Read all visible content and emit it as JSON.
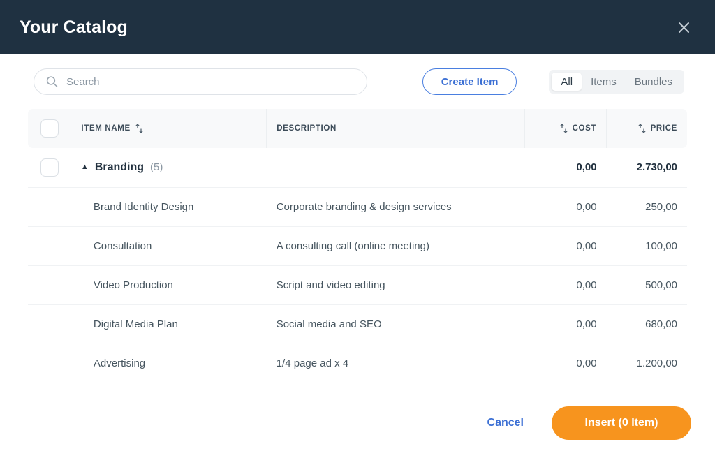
{
  "titlebar": {
    "title": "Your Catalog",
    "close_icon": "close-icon"
  },
  "toolbar": {
    "search": {
      "placeholder": "Search",
      "value": "",
      "icon": "search-icon"
    },
    "create_item_label": "Create Item",
    "filters": [
      {
        "label": "All",
        "active": true
      },
      {
        "label": "Items",
        "active": false
      },
      {
        "label": "Bundles",
        "active": false
      }
    ]
  },
  "table": {
    "columns": [
      {
        "key": "check",
        "label": "",
        "sortable": false
      },
      {
        "key": "name",
        "label": "ITEM NAME",
        "sortable": true
      },
      {
        "key": "description",
        "label": "DESCRIPTION",
        "sortable": false
      },
      {
        "key": "cost",
        "label": "COST",
        "sortable": true
      },
      {
        "key": "price",
        "label": "PRICE",
        "sortable": true
      }
    ],
    "group": {
      "name": "Branding",
      "count": "(5)",
      "expanded": true,
      "caret_icon": "caret-up-icon",
      "cost": "0,00",
      "price": "2.730,00"
    },
    "rows": [
      {
        "name": "Brand Identity Design",
        "description": "Corporate branding & design services",
        "cost": "0,00",
        "price": "250,00"
      },
      {
        "name": "Consultation",
        "description": "A consulting call (online meeting)",
        "cost": "0,00",
        "price": "100,00"
      },
      {
        "name": "Video Production",
        "description": "Script and video editing",
        "cost": "0,00",
        "price": "500,00"
      },
      {
        "name": "Digital Media Plan",
        "description": "Social media and SEO",
        "cost": "0,00",
        "price": "680,00"
      },
      {
        "name": "Advertising",
        "description": "1/4 page ad x 4",
        "cost": "0,00",
        "price": "1.200,00"
      }
    ]
  },
  "footer": {
    "cancel_label": "Cancel",
    "insert_label": "Insert (0 Item)"
  },
  "colors": {
    "titlebar_bg": "#1f3141",
    "accent_blue": "#3b6fd4",
    "accent_orange": "#f7941e",
    "header_bg": "#f8f9fa",
    "text_dark": "#22313f",
    "text_muted": "#8b97a2"
  }
}
